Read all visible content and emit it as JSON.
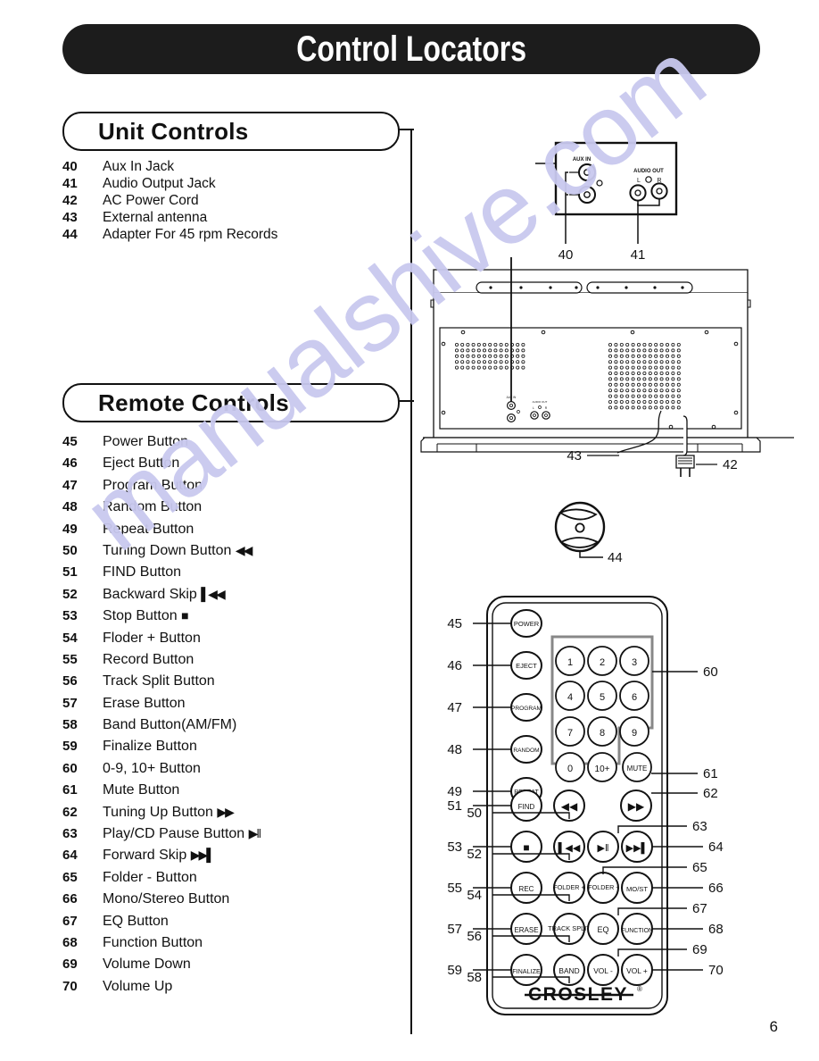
{
  "page": {
    "title": "Control Locators",
    "number": "6",
    "watermark": "manualshive.com",
    "brand": "CROSLEY",
    "brand_mark": "®"
  },
  "sections": [
    {
      "id": "unit-controls",
      "heading": "Unit Controls",
      "items": [
        {
          "num": "40",
          "label": "Aux In Jack"
        },
        {
          "num": "41",
          "label": "Audio Output Jack"
        },
        {
          "num": "42",
          "label": "AC Power Cord"
        },
        {
          "num": "43",
          "label": "External antenna"
        },
        {
          "num": "44",
          "label": "Adapter For 45 rpm Records"
        }
      ]
    },
    {
      "id": "remote-controls",
      "heading": "Remote Controls",
      "items": [
        {
          "num": "45",
          "label": "Power Button",
          "glyph": ""
        },
        {
          "num": "46",
          "label": "Eject Button",
          "glyph": ""
        },
        {
          "num": "47",
          "label": "Program Button",
          "glyph": ""
        },
        {
          "num": "48",
          "label": "Random Button",
          "glyph": ""
        },
        {
          "num": "49",
          "label": "Repeat Button",
          "glyph": ""
        },
        {
          "num": "50",
          "label": "Tuning Down Button ",
          "glyph": "◀◀"
        },
        {
          "num": "51",
          "label": "FIND Button",
          "glyph": ""
        },
        {
          "num": "52",
          "label": "Backward Skip ",
          "glyph": "▌◀◀"
        },
        {
          "num": "53",
          "label": "Stop Button ",
          "glyph": "■"
        },
        {
          "num": "54",
          "label": "Floder + Button",
          "glyph": ""
        },
        {
          "num": "55",
          "label": "Record Button",
          "glyph": ""
        },
        {
          "num": "56",
          "label": "Track Split Button",
          "glyph": ""
        },
        {
          "num": "57",
          "label": "Erase Button",
          "glyph": ""
        },
        {
          "num": "58",
          "label": "Band Button(AM/FM)",
          "glyph": ""
        },
        {
          "num": "59",
          "label": "Finalize Button",
          "glyph": ""
        },
        {
          "num": "60",
          "label": "0-9, 10+ Button",
          "glyph": ""
        },
        {
          "num": "61",
          "label": "Mute Button",
          "glyph": ""
        },
        {
          "num": "62",
          "label": "Tuning Up Button ",
          "glyph": "▶▶"
        },
        {
          "num": "63",
          "label": "Play/CD Pause Button ",
          "glyph": "▶‖"
        },
        {
          "num": "64",
          "label": "Forward Skip ",
          "glyph": "▶▶▌"
        },
        {
          "num": "65",
          "label": "Folder - Button",
          "glyph": ""
        },
        {
          "num": "66",
          "label": "Mono/Stereo Button",
          "glyph": ""
        },
        {
          "num": "67",
          "label": "EQ Button",
          "glyph": ""
        },
        {
          "num": "68",
          "label": "Function Button",
          "glyph": ""
        },
        {
          "num": "69",
          "label": "Volume Down",
          "glyph": ""
        },
        {
          "num": "70",
          "label": "Volume Up",
          "glyph": ""
        }
      ]
    }
  ],
  "diagrams": {
    "jack_panel": {
      "aux_in_label": "AUX IN",
      "audio_out_label": "AUDIO OUT",
      "channel_left": "L",
      "channel_right": "R",
      "callouts": [
        "40",
        "41"
      ]
    },
    "rear_view": {
      "callouts": [
        "43",
        "42"
      ]
    },
    "adapter_45rpm": {
      "callouts": [
        "44"
      ]
    },
    "remote": {
      "keypad_rows": [
        [
          "1",
          "2",
          "3"
        ],
        [
          "4",
          "5",
          "6"
        ],
        [
          "7",
          "8",
          "9"
        ],
        [
          "0",
          "10+"
        ]
      ],
      "mute_key": "MUTE",
      "left_column_keys": [
        "POWER",
        "EJECT",
        "PROGRAM",
        "RANDOM",
        "REPEAT"
      ],
      "function_rows": [
        [
          "FIND",
          "◀◀",
          "",
          "▶▶"
        ],
        [
          "■",
          "▌◀◀",
          "▶‖",
          "▶▶▌"
        ],
        [
          "REC",
          "FOLDER +",
          "FOLDER -",
          "MO/ST"
        ],
        [
          "ERASE",
          "TRACK SPLIT",
          "EQ",
          "FUNCTION"
        ],
        [
          "FINALIZE",
          "BAND",
          "VOL -",
          "VOL +"
        ]
      ],
      "callouts_left": [
        "45",
        "46",
        "47",
        "48",
        "49",
        "50",
        "51",
        "52",
        "53",
        "54",
        "55",
        "56",
        "57",
        "58",
        "59"
      ],
      "callouts_right": [
        "60",
        "61",
        "62",
        "63",
        "64",
        "65",
        "66",
        "67",
        "68",
        "69",
        "70"
      ]
    }
  },
  "colors": {
    "banner_bg": "#1c1c1c",
    "banner_text": "#ffffff",
    "ink": "#111111",
    "watermark": "#c9c9ef",
    "paper": "#ffffff"
  }
}
